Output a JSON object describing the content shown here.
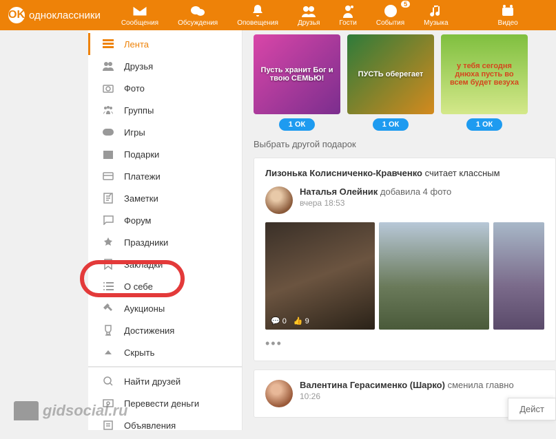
{
  "logo": {
    "text": "одноклассники",
    "symbol": "OK"
  },
  "nav": [
    {
      "label": "Сообщения",
      "icon": "mail"
    },
    {
      "label": "Обсуждения",
      "icon": "chat"
    },
    {
      "label": "Оповещения",
      "icon": "bell"
    },
    {
      "label": "Друзья",
      "icon": "friends"
    },
    {
      "label": "Гости",
      "icon": "guests"
    },
    {
      "label": "События",
      "icon": "events",
      "badge": "5"
    },
    {
      "label": "Музыка",
      "icon": "music"
    },
    {
      "label": "Видео",
      "icon": "video"
    }
  ],
  "sidebar": {
    "items": [
      {
        "label": "Лента",
        "icon": "feed",
        "active": true
      },
      {
        "label": "Друзья",
        "icon": "friends"
      },
      {
        "label": "Фото",
        "icon": "photo"
      },
      {
        "label": "Группы",
        "icon": "groups"
      },
      {
        "label": "Игры",
        "icon": "games"
      },
      {
        "label": "Подарки",
        "icon": "gifts"
      },
      {
        "label": "Платежи",
        "icon": "payments"
      },
      {
        "label": "Заметки",
        "icon": "notes"
      },
      {
        "label": "Форум",
        "icon": "forum"
      },
      {
        "label": "Праздники",
        "icon": "holidays"
      },
      {
        "label": "Закладки",
        "icon": "bookmarks"
      },
      {
        "label": "О себе",
        "icon": "about"
      },
      {
        "label": "Аукционы",
        "icon": "auctions"
      },
      {
        "label": "Достижения",
        "icon": "achievements"
      },
      {
        "label": "Скрыть",
        "icon": "hide"
      }
    ],
    "bottom": [
      {
        "label": "Найти друзей",
        "icon": "search"
      },
      {
        "label": "Перевести деньги",
        "icon": "money"
      },
      {
        "label": "Объявления",
        "icon": "ads"
      }
    ]
  },
  "gifts": {
    "badge": "1 ОК",
    "other_link": "Выбрать другой подарок",
    "items": [
      {
        "bg": "linear-gradient(135deg,#d946a8 0%,#7b2e8e 100%)",
        "text": "Пусть хранит Бог и твою СЕМЬЮ!"
      },
      {
        "bg": "linear-gradient(135deg,#2e7b3a 0%,#d48a1e 100%)",
        "text": "ПУСТЬ оберегает"
      },
      {
        "bg": "linear-gradient(180deg,#7fbf3f 0%,#d4e88a 100%)",
        "text": "у тебя сегодня днюха пусть во всем будет везуха"
      }
    ]
  },
  "feed": {
    "block1": {
      "header_name": "Лизонька Колисниченко-Кравченко",
      "header_action": "считает классным",
      "author": "Наталья Олейник",
      "action": "добавила 4 фото",
      "time": "вчера 18:53",
      "stats": {
        "klass": "0",
        "like": "9"
      }
    },
    "block2": {
      "author": "Валентина Герасименко (Шарко)",
      "action": "сменила главно",
      "time": "10:26"
    }
  },
  "action_button": "Дейст",
  "watermark": "gidsocial.ru"
}
